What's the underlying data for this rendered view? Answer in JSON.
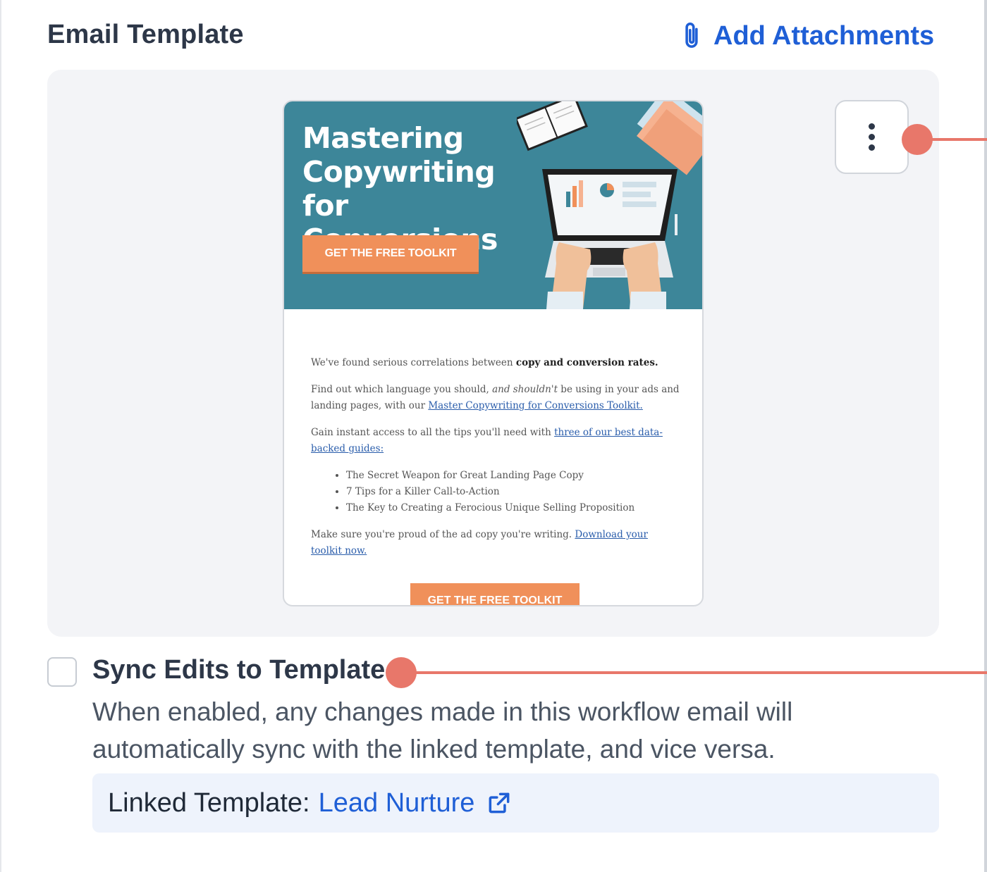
{
  "section": {
    "title": "Email Template",
    "add_attachments_label": "Add Attachments"
  },
  "email_preview": {
    "hero_title_lines": [
      "Mastering",
      "Copywriting for",
      "Conversions"
    ],
    "hero_button": "GET THE FREE TOOLKIT",
    "intro_text": "We've found serious correlations between",
    "intro_bold": "copy and conversion rates.",
    "para2_text_1": "Find out which language you should,",
    "para2_italic": "and shouldn't",
    "para2_text_2": "be using in your ads and landing pages, with our",
    "para2_link": "Master Copywriting for Conversions Toolkit.",
    "para3_text": "Gain instant access to all the tips you'll need with",
    "para3_link": "three of our best data-backed guides:",
    "bullets": [
      "The Secret Weapon for Great Landing Page Copy",
      "7 Tips for a Killer Call-to-Action",
      "The Key to Creating a Ferocious Unique Selling Proposition"
    ],
    "para4_text": "Make sure you're proud of the ad copy you're writing.",
    "para4_link": "Download your toolkit now.",
    "footer_button": "GET THE FREE TOOLKIT"
  },
  "sync": {
    "checked": false,
    "label": "Sync Edits to Template",
    "description": "When enabled, any changes made in this workflow email will automatically sync with the linked template, and vice versa."
  },
  "linked_template": {
    "label": "Linked Template:",
    "name": "Lead Nurture"
  },
  "colors": {
    "accent_blue": "#1f5fd6",
    "callout": "#e8776a",
    "hero_teal": "#3d8699",
    "cta_orange": "#f0905a"
  },
  "icons": {
    "attachment": "paperclip-icon",
    "menu": "kebab-menu-icon",
    "external": "external-link-icon"
  }
}
